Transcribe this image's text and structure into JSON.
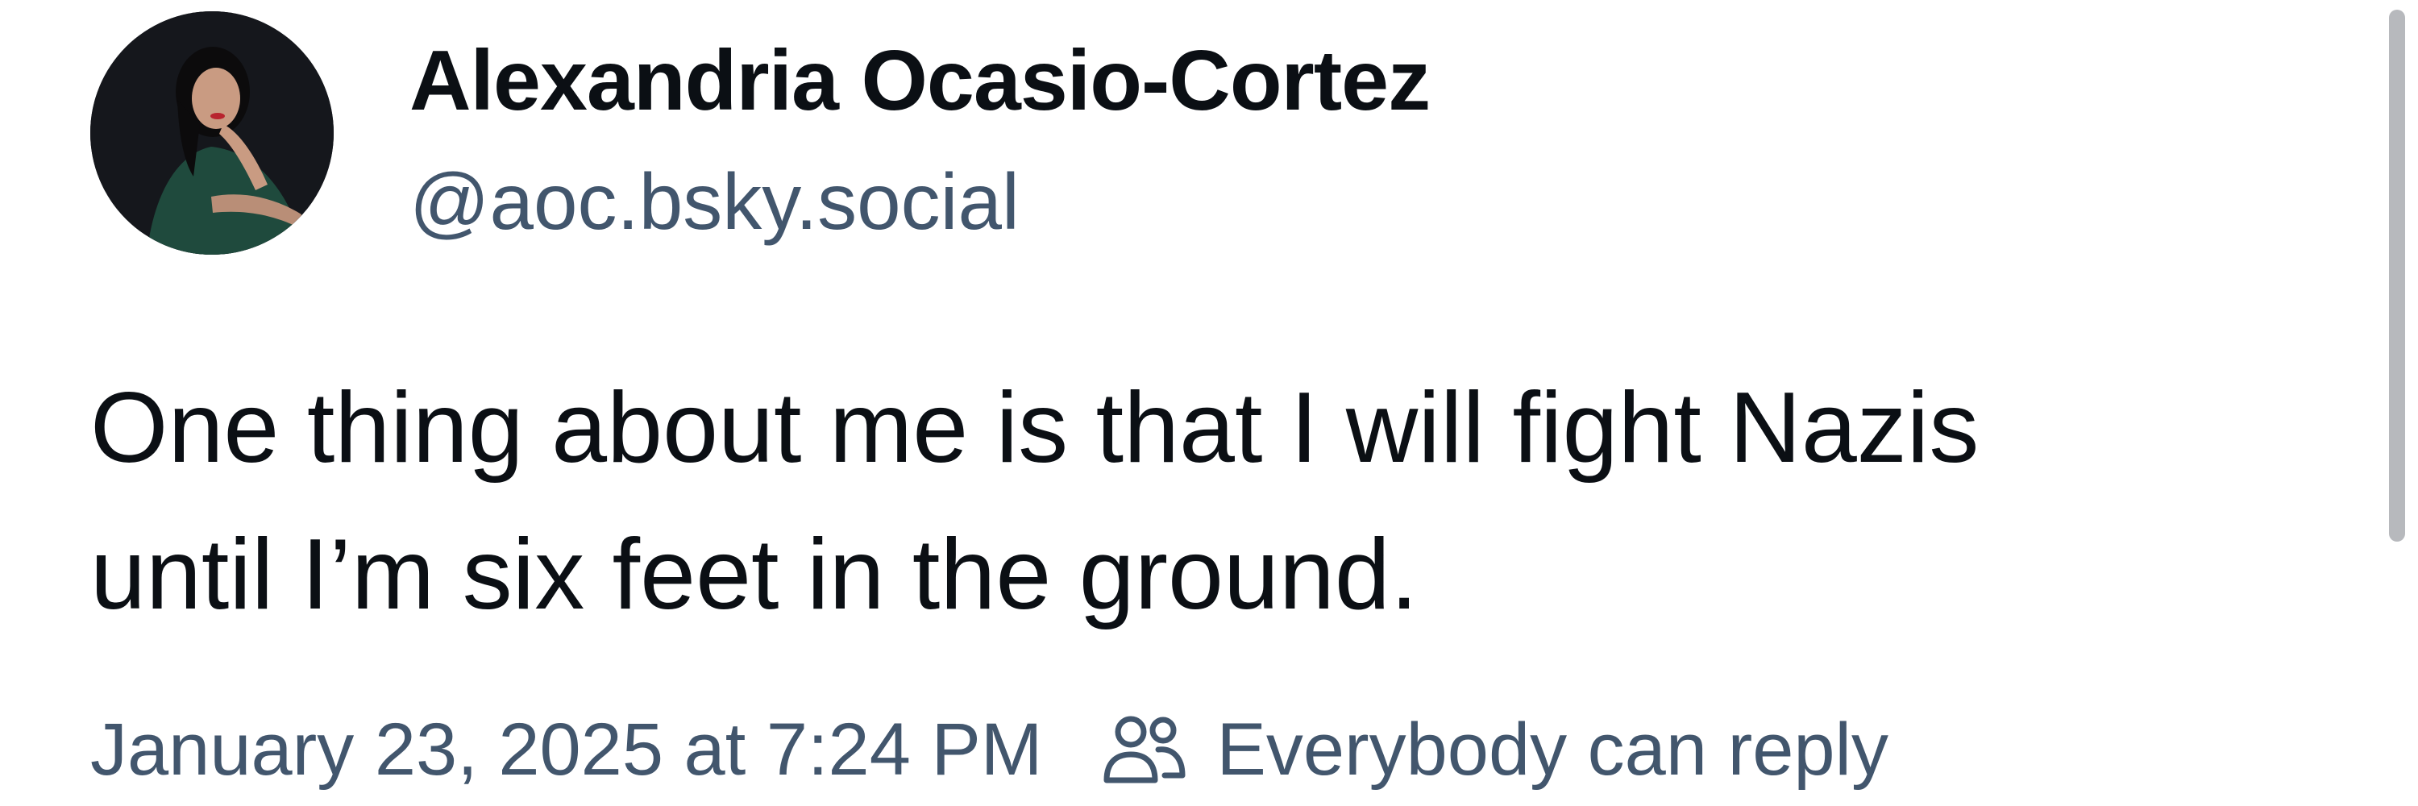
{
  "post": {
    "author": {
      "display_name": "Alexandria Ocasio-Cortez",
      "handle": "@aoc.bsky.social",
      "avatar_icon": "profile-photo"
    },
    "text_lines": [
      "One thing about me is that I will fight Nazis",
      "until I’m six feet in the ground."
    ],
    "timestamp": "January 23, 2025 at 7:24 PM",
    "reply_setting": {
      "icon": "people-icon",
      "label": "Everybody can reply"
    }
  },
  "colors": {
    "text_primary": "#0b0f14",
    "text_secondary": "#42566d",
    "background": "#ffffff",
    "scrollbar": "#b7b9bd"
  }
}
